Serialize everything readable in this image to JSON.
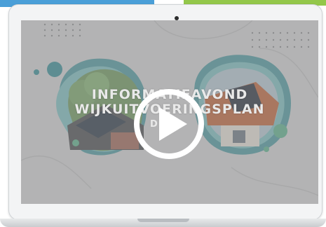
{
  "video": {
    "title_line1": "INFORMATIEAVOND",
    "title_line2": "WIJKUITVOERINGSPLAN",
    "subtitle": "D",
    "play_icon": "play-icon"
  },
  "colors": {
    "accent_blue": "#4a9fd8",
    "accent_green": "#93c74a",
    "teal": "#3a8f97",
    "overlay": "#8c8c8c"
  }
}
